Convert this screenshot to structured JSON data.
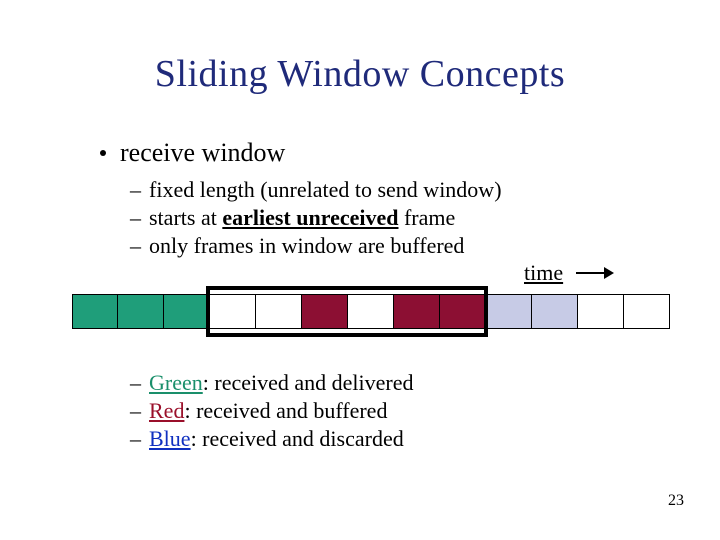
{
  "title": "Sliding Window Concepts",
  "bullet": "receive window",
  "sub": {
    "a": "fixed length (unrelated to send window)",
    "b_prefix": "starts at ",
    "b_bold": "earliest unreceived",
    "b_suffix": " frame",
    "c": "only frames in window are buffered"
  },
  "time_label": "time",
  "legend": {
    "green_label": "Green",
    "green_rest": ": received and delivered",
    "red_label": "Red",
    "red_rest": ": received and buffered",
    "blue_label": "Blue",
    "blue_rest": ": received and discarded"
  },
  "frames": [
    "green",
    "green",
    "green",
    "white",
    "white",
    "red",
    "white",
    "red",
    "red",
    "blue",
    "blue",
    "white",
    "white"
  ],
  "window": {
    "start_index": 3,
    "length": 6
  },
  "page": "23"
}
